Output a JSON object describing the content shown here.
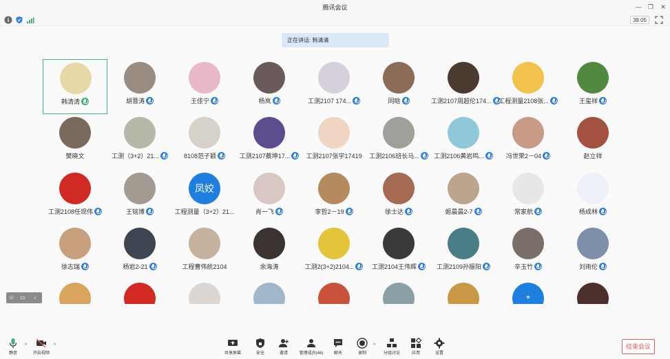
{
  "window": {
    "title": "腾讯会议"
  },
  "topbar": {
    "timer": "38:05"
  },
  "speaking_banner": "正在讲话: 韩清清",
  "participants": [
    {
      "name": "韩清清",
      "mic": "green",
      "bg": "#e8d9a8",
      "active": true
    },
    {
      "name": "胡晋涛",
      "mic": "blue",
      "bg": "#9a8c80"
    },
    {
      "name": "王佳宁",
      "mic": "blue",
      "bg": "#e9b9c7"
    },
    {
      "name": "杨岚",
      "mic": "blue",
      "bg": "#6b5a5a"
    },
    {
      "name": "工测2107    174...",
      "mic": "blue",
      "bg": "#d6d0da"
    },
    {
      "name": "同晗",
      "mic": "blue",
      "bg": "#8a6c58"
    },
    {
      "name": "工测2107周超伦174...",
      "mic": "blue",
      "bg": "#4a3a30"
    },
    {
      "name": "工程测量2108张...",
      "mic": "blue",
      "bg": "#f3c24a"
    },
    {
      "name": "王玺祥",
      "mic": "blue",
      "bg": "#4f8a3e"
    },
    {
      "name": "樊晓文",
      "mic": "",
      "bg": "#7a6a5c"
    },
    {
      "name": "工测（3+2）21...",
      "mic": "blue",
      "bg": "#b7b9a8"
    },
    {
      "name": "8108范子颖",
      "mic": "blue",
      "bg": "#d7d2c9"
    },
    {
      "name": "工测2107蔡坤17...",
      "mic": "blue",
      "bg": "#5d4d8f"
    },
    {
      "name": "工测2107张宇17419",
      "mic": "",
      "bg": "#f0d6c2"
    },
    {
      "name": "工测2106班长马...",
      "mic": "blue",
      "bg": "#9ea09a"
    },
    {
      "name": "工测2106黄岩鸣...",
      "mic": "blue",
      "bg": "#8fc8db"
    },
    {
      "name": "冯世荣2－04",
      "mic": "blue",
      "bg": "#c99a86"
    },
    {
      "name": "赵立祥",
      "mic": "",
      "bg": "#a2523e"
    },
    {
      "name": "工测2108任现伟",
      "mic": "blue",
      "bg": "#d12a24"
    },
    {
      "name": "王铭博",
      "mic": "blue",
      "bg": "#a39b92"
    },
    {
      "name": "工程测量（3+2）21...",
      "mic": "",
      "bg": "#1e7fe0",
      "text": "凤姣"
    },
    {
      "name": "肖一飞",
      "mic": "blue",
      "bg": "#d9c7c3"
    },
    {
      "name": "李哲2－19",
      "mic": "blue",
      "bg": "#b48a5e"
    },
    {
      "name": "徐士达",
      "mic": "blue",
      "bg": "#a46b52"
    },
    {
      "name": "姬晨晨2-7",
      "mic": "blue",
      "bg": "#bca58e"
    },
    {
      "name": "常家航",
      "mic": "blue",
      "bg": "#e9e6e6"
    },
    {
      "name": "杨成林",
      "mic": "blue",
      "bg": "#eef2f8"
    },
    {
      "name": "徐志瑞",
      "mic": "blue",
      "bg": "#c9a07e"
    },
    {
      "name": "杨岩2-21",
      "mic": "blue",
      "bg": "#3e4552"
    },
    {
      "name": "工程曹伟航2104",
      "mic": "",
      "bg": "#c7b2a0"
    },
    {
      "name": "余海涛",
      "mic": "",
      "bg": "#3a3330"
    },
    {
      "name": "工测2(3+2)2104...",
      "mic": "blue",
      "bg": "#e3c43a"
    },
    {
      "name": "工测2104王伟辉",
      "mic": "blue",
      "bg": "#3a3a3a"
    },
    {
      "name": "工测2109孙振阳",
      "mic": "blue",
      "bg": "#4a7e86"
    },
    {
      "name": "辛玉竹",
      "mic": "blue",
      "bg": "#7b6e68"
    },
    {
      "name": "刘雨伦",
      "mic": "blue",
      "bg": "#7e8faa"
    },
    {
      "name": "",
      "mic": "",
      "bg": "#d9a55e"
    },
    {
      "name": "",
      "mic": "",
      "bg": "#d22a22"
    },
    {
      "name": "",
      "mic": "",
      "bg": "#ddd7d3"
    },
    {
      "name": "",
      "mic": "",
      "bg": "#9fb7c8"
    },
    {
      "name": "",
      "mic": "",
      "bg": "#c9523a"
    },
    {
      "name": "",
      "mic": "",
      "bg": "#8aa0a6"
    },
    {
      "name": "",
      "mic": "",
      "bg": "#c99845"
    },
    {
      "name": "",
      "mic": "",
      "bg": "#1e7fe0",
      "text": "*"
    },
    {
      "name": "",
      "mic": "",
      "bg": "#4a2f2a"
    }
  ],
  "toolbar": {
    "mute": "静音",
    "video": "开启视频",
    "share": "共享屏幕",
    "security": "安全",
    "record_invite": "邀请",
    "members": "管理成员(46)",
    "chat": "聊天",
    "record": "录制",
    "breakout": "分组讨论",
    "apps": "应用",
    "settings": "设置",
    "end": "结束会议"
  }
}
